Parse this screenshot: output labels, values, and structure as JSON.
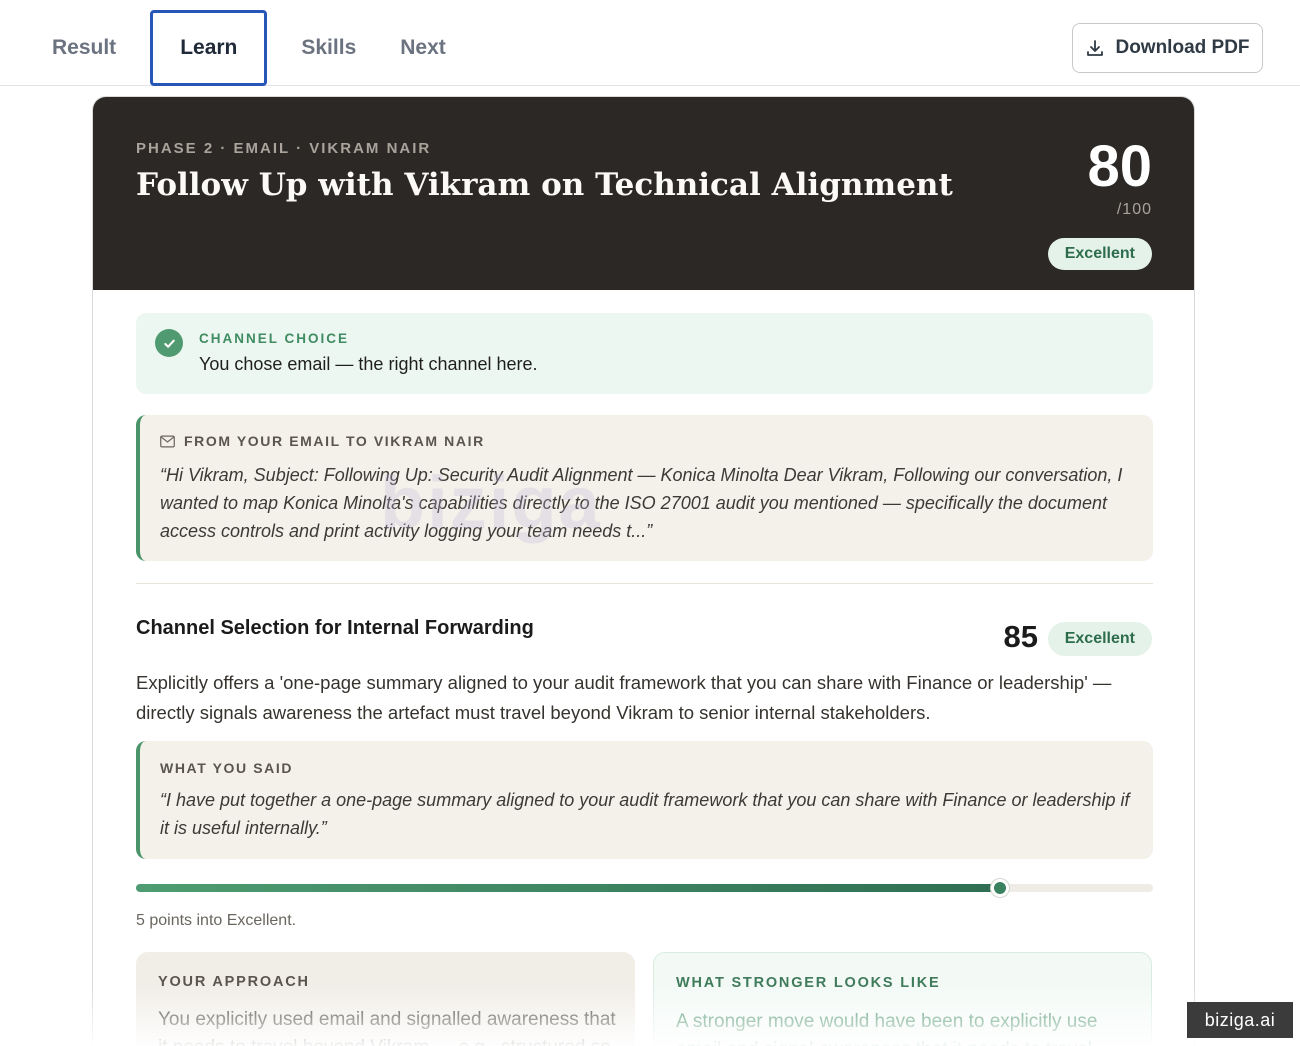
{
  "nav": {
    "tabs": [
      {
        "label": "Result",
        "active": false
      },
      {
        "label": "Learn",
        "active": true
      },
      {
        "label": "Skills",
        "active": false
      },
      {
        "label": "Next",
        "active": false
      }
    ],
    "download_label": "Download PDF",
    "download_icon": "download-icon"
  },
  "hero": {
    "kicker": "PHASE 2 · EMAIL · VIKRAM NAIR",
    "title": "Follow Up with Vikram on Technical Alignment",
    "score": "80",
    "out_of": "/100",
    "badge": "Excellent"
  },
  "channel": {
    "label": "CHANNEL CHOICE",
    "text": "You chose email — the right channel here.",
    "icon": "check-icon"
  },
  "email": {
    "label": "FROM YOUR EMAIL TO VIKRAM NAIR",
    "icon": "mail-icon",
    "quote": "“Hi Vikram, Subject: Following Up: Security Audit Alignment — Konica Minolta Dear Vikram, Following our conversation, I wanted to map Konica Minolta's capabilities directly to the ISO 27001 audit you mentioned — specifically the document access controls and print activity logging your team needs t...”"
  },
  "watermark": "biziga",
  "skill": {
    "title": "Channel Selection for Internal Forwarding",
    "score": "85",
    "badge": "Excellent",
    "description": "Explicitly offers a 'one-page summary aligned to your audit framework that you can share with Finance or leadership' — directly signals awareness the artefact must travel beyond Vikram to senior internal stakeholders.",
    "said_label": "WHAT YOU SAID",
    "said_quote": "“I have put together a one-page summary aligned to your audit framework that you can share with Finance or leadership if it is useful internally.”",
    "progress": 0.85,
    "progress_note": "5 points into Excellent.",
    "approach_label": "YOUR APPROACH",
    "approach_text": "You explicitly used email and signalled awareness that it needs to travel beyond Vikram — e.g., structured so",
    "stronger_label": "WHAT STRONGER LOOKS LIKE",
    "stronger_text": "A stronger move would have been to explicitly use email and signal awareness that it needs to travel"
  },
  "brand": "biziga.ai",
  "colors": {
    "accent_blue": "#2657b8",
    "hero_bg": "#2b2825",
    "success_green": "#4f9a70",
    "badge_bg": "#e4f2ea"
  }
}
